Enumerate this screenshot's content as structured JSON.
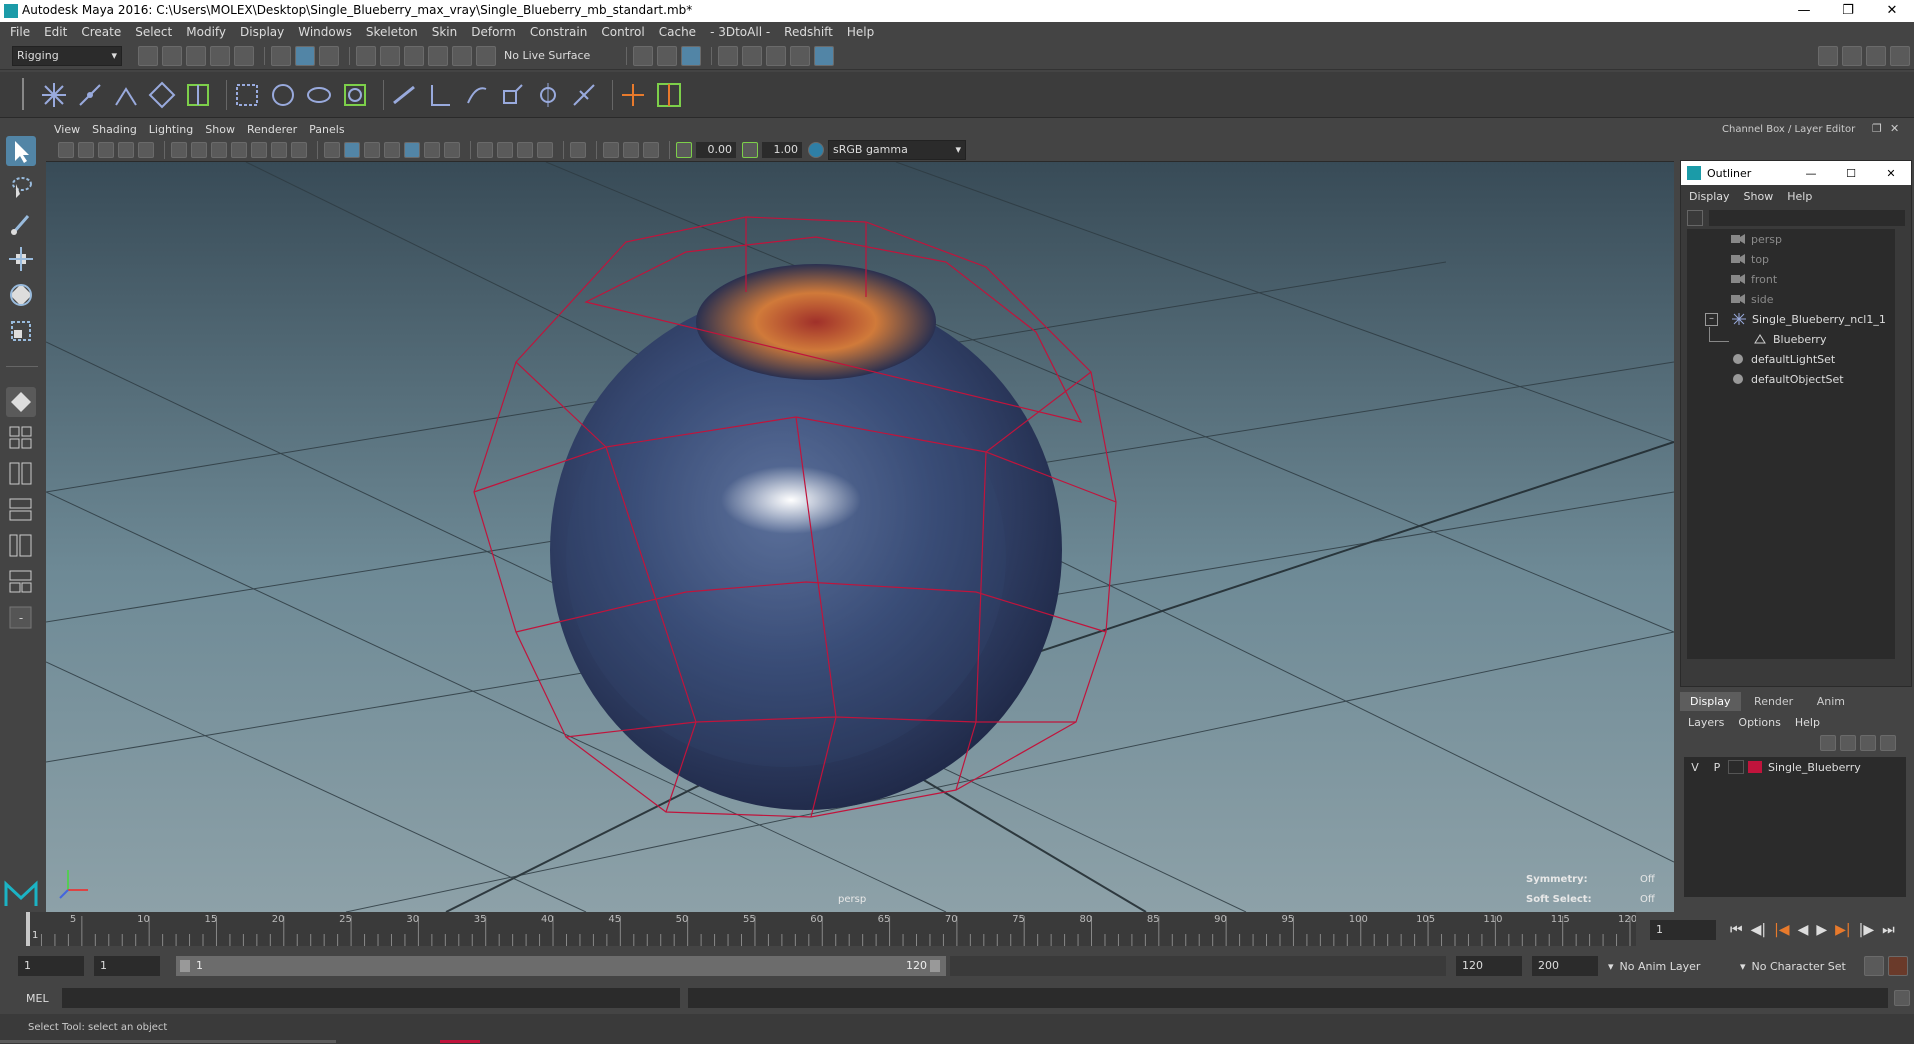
{
  "app": {
    "title": "Autodesk Maya 2016: C:\\Users\\MOLEX\\Desktop\\Single_Blueberry_max_vray\\Single_Blueberry_mb_standart.mb*"
  },
  "menu": [
    "File",
    "Edit",
    "Create",
    "Select",
    "Modify",
    "Display",
    "Windows",
    "Skeleton",
    "Skin",
    "Deform",
    "Constrain",
    "Control",
    "Cache",
    "- 3DtoAll -",
    "Redshift",
    "Help"
  ],
  "statusline": {
    "menuset": "Rigging",
    "live_surface": "No Live Surface"
  },
  "viewport": {
    "menu": [
      "View",
      "Shading",
      "Lighting",
      "Show",
      "Renderer",
      "Panels"
    ],
    "exposure": "0.00",
    "gamma": "1.00",
    "color_space": "sRGB gamma",
    "camera_label": "persp",
    "hud": {
      "symmetry_label": "Symmetry:",
      "symmetry_value": "Off",
      "soft_select_label": "Soft Select:",
      "soft_select_value": "Off"
    }
  },
  "channelbox": {
    "title": "Channel Box / Layer Editor"
  },
  "outliner": {
    "title": "Outliner",
    "menu": [
      "Display",
      "Show",
      "Help"
    ],
    "items": [
      {
        "label": "persp"
      },
      {
        "label": "top"
      },
      {
        "label": "front"
      },
      {
        "label": "side"
      },
      {
        "label": "Single_Blueberry_ncl1_1"
      },
      {
        "label": "Blueberry"
      },
      {
        "label": "defaultLightSet"
      },
      {
        "label": "defaultObjectSet"
      }
    ]
  },
  "layer_editor": {
    "tabs": [
      "Display",
      "Render",
      "Anim"
    ],
    "menu": [
      "Layers",
      "Options",
      "Help"
    ],
    "layer": {
      "v": "V",
      "p": "P",
      "name": "Single_Blueberry",
      "color": "#c0143c"
    }
  },
  "timeline": {
    "ticks": [
      "5",
      "10",
      "15",
      "20",
      "25",
      "30",
      "35",
      "40",
      "45",
      "50",
      "55",
      "60",
      "65",
      "70",
      "75",
      "80",
      "85",
      "90",
      "95",
      "100",
      "105",
      "110",
      "115",
      "120"
    ],
    "current_frame": "1",
    "first_tick": "1"
  },
  "range": {
    "start": "1",
    "playback_start": "1",
    "slider_start": "1",
    "slider_end": "120",
    "playback_end": "120",
    "end": "200",
    "anim_layer": "No Anim Layer",
    "character_set": "No Character Set"
  },
  "command": {
    "lang": "MEL"
  },
  "status": {
    "help": "Select Tool: select an object"
  },
  "colors": {
    "accent": "#5285a6",
    "wire": "#c0143c",
    "berry": "#3c4f7a"
  }
}
